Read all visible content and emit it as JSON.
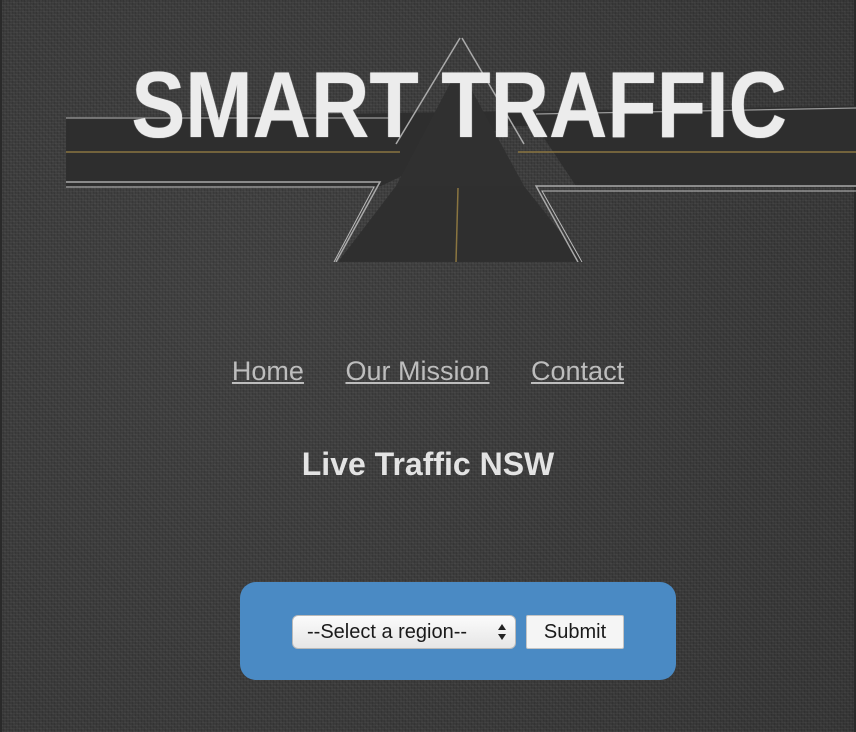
{
  "banner": {
    "title": "SMART TRAFFIC"
  },
  "nav": {
    "items": [
      {
        "label": "Home"
      },
      {
        "label": "Our Mission"
      },
      {
        "label": "Contact"
      }
    ]
  },
  "main": {
    "heading": "Live Traffic NSW"
  },
  "form": {
    "region_select": {
      "selected": "--Select a region--"
    },
    "submit_label": "Submit"
  },
  "colors": {
    "background": "#3a3a3a",
    "panel": "#4a8ac4",
    "link": "#bdbdbd",
    "heading": "#e3e3e3",
    "banner_road": "#2e2e2e",
    "road_line_gold": "#8a7540"
  },
  "icons": {
    "select_arrows": "up-down-arrows-icon"
  }
}
